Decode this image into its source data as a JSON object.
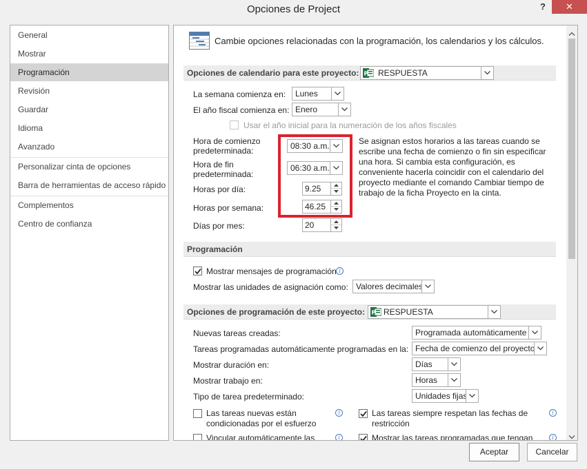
{
  "window": {
    "title": "Opciones de Project",
    "help": "?",
    "close": "✕"
  },
  "nav": {
    "items": [
      "General",
      "Mostrar",
      "Programación",
      "Revisión",
      "Guardar",
      "Idioma",
      "Avanzado",
      "Personalizar cinta de opciones",
      "Barra de herramientas de acceso rápido",
      "Complementos",
      "Centro de confianza"
    ],
    "active": "Programación"
  },
  "header": {
    "text": "Cambie opciones relacionadas con la programación, los calendarios y los cálculos."
  },
  "calendar": {
    "section_title": "Opciones de calendario para este proyecto:",
    "project": "RESPUESTA",
    "week_start_label": "La semana comienza en:",
    "week_start_value": "Lunes",
    "fiscal_label": "El año fiscal comienza en:",
    "fiscal_value": "Enero",
    "fiscal_checkbox_label": "Usar el año inicial para la numeración de los años fiscales",
    "start_time_label_1": "Hora de comienzo",
    "start_time_label_2": "predeterminada:",
    "start_time_value": "08:30 a.m.",
    "end_time_label_1": "Hora de fin",
    "end_time_label_2": "predeterminada:",
    "end_time_value": "06:30 a.m.",
    "hours_day_label": "Horas por día:",
    "hours_day_value": "9.25",
    "hours_week_label": "Horas por semana:",
    "hours_week_value": "46.25",
    "days_month_label": "Días por mes:",
    "days_month_value": "20",
    "description": "Se asignan estos horarios a las tareas cuando se escribe una fecha de comienzo o fin sin especificar una hora. Si cambia esta configuración, es conveniente hacerla coincidir con el calendario del proyecto mediante el comando Cambiar tiempo de trabajo de la ficha Proyecto en la cinta."
  },
  "scheduling": {
    "section_title": "Programación",
    "show_messages_label": "Mostrar mensajes de programación",
    "units_label": "Mostrar las unidades de asignación como:",
    "units_value": "Valores decimales"
  },
  "project_sched": {
    "section_title": "Opciones de programación de este proyecto:",
    "project": "RESPUESTA",
    "new_tasks_label": "Nuevas tareas creadas:",
    "new_tasks_value": "Programada automáticamente",
    "auto_tasks_label": "Tareas programadas automáticamente programadas en la:",
    "auto_tasks_value": "Fecha de comienzo del proyecto",
    "duration_label": "Mostrar duración en:",
    "duration_value": "Días",
    "work_label": "Mostrar trabajo en:",
    "work_value": "Horas",
    "task_type_label": "Tipo de tarea predeterminado:",
    "task_type_value": "Unidades fijas",
    "cb1_line1": "Las tareas nuevas están",
    "cb1_line2": "condicionadas por el esfuerzo",
    "cb2_line1": "Las tareas siempre respetan las fechas de",
    "cb2_line2": "restricción",
    "cb3_line1": "Vincular automáticamente las",
    "cb4_line1": "Mostrar las tareas programadas que tengan"
  },
  "buttons": {
    "ok": "Aceptar",
    "cancel": "Cancelar"
  },
  "colors": {
    "highlight_box": "#d9232e",
    "nav_active": "#d4d4d4",
    "close": "#c75050"
  }
}
